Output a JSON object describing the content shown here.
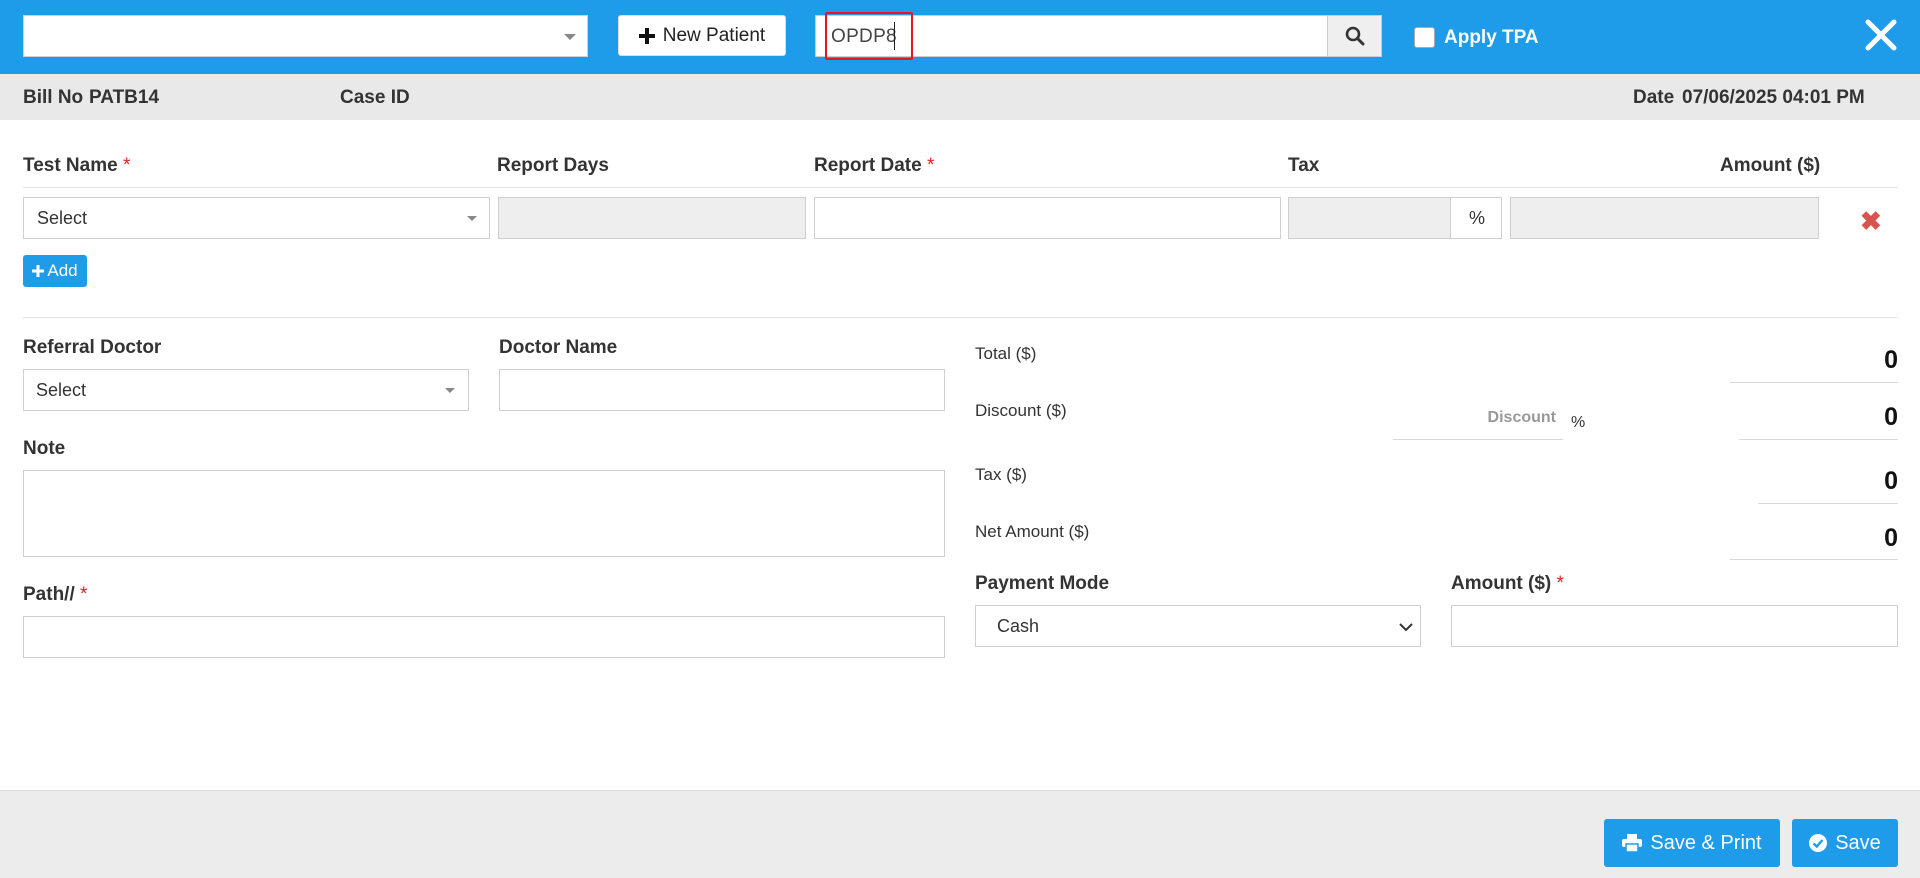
{
  "header": {
    "patient_select_value": "",
    "new_patient_label": "New Patient",
    "search_value": "OPDP8",
    "apply_tpa_label": "Apply TPA"
  },
  "info": {
    "bill_no_label": "Bill No",
    "bill_no_value": "PATB14",
    "case_id_label": "Case ID",
    "date_label": "Date",
    "date_value": "07/06/2025 04:01 PM"
  },
  "test_table": {
    "columns": {
      "test_name": "Test Name",
      "report_days": "Report Days",
      "report_date": "Report Date",
      "tax": "Tax",
      "amount": "Amount ($)"
    },
    "row": {
      "test_name_value": "Select",
      "tax_suffix": "%"
    },
    "add_label": "Add"
  },
  "form": {
    "referral_doctor_label": "Referral Doctor",
    "referral_doctor_value": "Select",
    "doctor_name_label": "Doctor Name",
    "note_label": "Note",
    "path_label": "Path//"
  },
  "summary": {
    "total_label": "Total ($)",
    "total_value": "0",
    "discount_label": "Discount ($)",
    "discount_placeholder": "Discount",
    "discount_suffix": "%",
    "discount_value": "0",
    "tax_label": "Tax ($)",
    "tax_value": "0",
    "net_amount_label": "Net Amount ($)",
    "net_amount_value": "0",
    "payment_mode_label": "Payment Mode",
    "payment_mode_value": "Cash",
    "amount_label": "Amount ($)"
  },
  "footer": {
    "save_print_label": "Save & Print",
    "save_label": "Save"
  },
  "colors": {
    "brand_blue": "#1e9be9",
    "required_red": "#e02020",
    "delete_red": "#d9534f"
  }
}
